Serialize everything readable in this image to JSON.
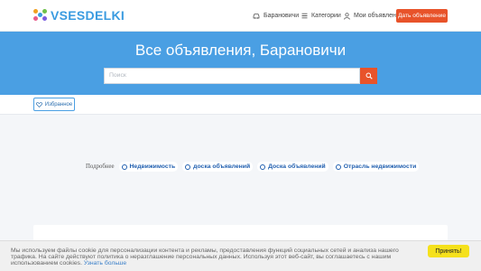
{
  "header": {
    "logo_text": "VSESDELKI",
    "nav": {
      "city": "Барановичи",
      "categories": "Категории",
      "my_ads": "Мои объявления"
    },
    "post_button": "Дать объявление"
  },
  "hero": {
    "title": "Все объявления, Барановичи",
    "search_placeholder": "Поиск"
  },
  "toolbar": {
    "favorites_label": "Избранное"
  },
  "tags": {
    "label": "Подробнее",
    "items": [
      "Недвижимость",
      "доска объявлений",
      "Доска объявлений",
      "Отрасль недвижимости"
    ]
  },
  "cookie": {
    "text": "Мы используем файлы cookie для персонализации контента и рекламы, предоставления функций социальных сетей и анализа нашего трафика. На сайте действуют политика о неразглашение персональных данных. Используя этот веб-сайт, вы соглашаетесь с нашим использованием cookies.",
    "link": "Узнать больше",
    "accept_button": "Принять!"
  },
  "colors": {
    "brand_blue": "#4a9fe3",
    "accent_orange": "#e8532a",
    "accept_yellow": "#f5e11c"
  }
}
